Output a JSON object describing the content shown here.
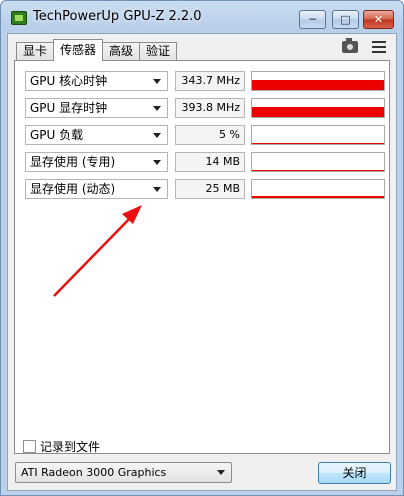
{
  "window": {
    "title": "TechPowerUp GPU-Z 2.2.0",
    "minimize_label": "─",
    "maximize_label": "□",
    "close_label": "✕"
  },
  "tabs": [
    {
      "label": "显卡",
      "active": false
    },
    {
      "label": "传感器",
      "active": true
    },
    {
      "label": "高级",
      "active": false
    },
    {
      "label": "验证",
      "active": false
    }
  ],
  "sensors": [
    {
      "name": "GPU 核心时钟",
      "value": "343.7 MHz",
      "graph_level": 0.55
    },
    {
      "name": "GPU 显存时钟",
      "value": "393.8 MHz",
      "graph_level": 0.55
    },
    {
      "name": "GPU 负载",
      "value": "5 %",
      "graph_level": 0.05
    },
    {
      "name": "显存使用 (专用)",
      "value": "14 MB",
      "graph_level": 0.05
    },
    {
      "name": "显存使用 (动态)",
      "value": "25 MB",
      "graph_level": 0.1
    }
  ],
  "log_to_file": {
    "label": "记录到文件",
    "checked": false
  },
  "gpu_select": {
    "value": "ATI Radeon 3000 Graphics"
  },
  "close_button": {
    "label": "关闭"
  },
  "colors": {
    "graph": "#ee0000",
    "annotation_arrow": "#e81010"
  },
  "icons": [
    "camera-icon",
    "menu-icon",
    "app-icon"
  ]
}
